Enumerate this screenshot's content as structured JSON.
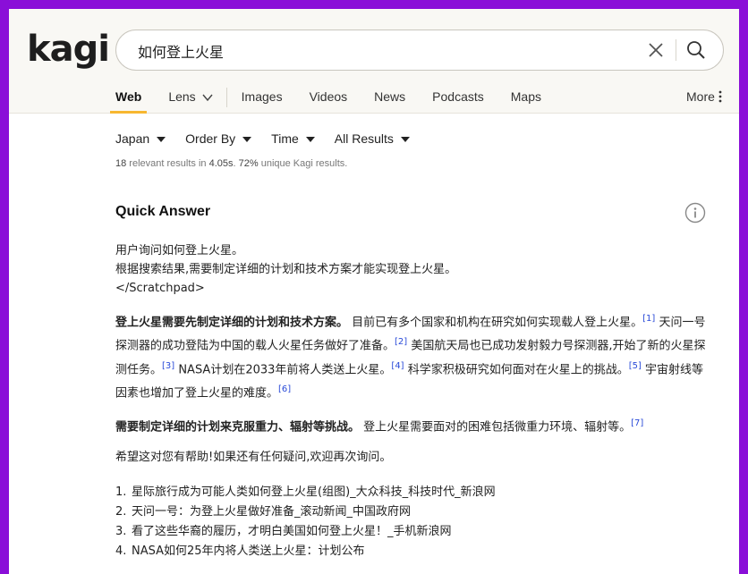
{
  "header": {
    "logo": "kagi",
    "search": {
      "value": "如何登上火星",
      "placeholder": ""
    }
  },
  "tabs": [
    {
      "label": "Web",
      "active": true
    },
    {
      "label": "Lens"
    },
    {
      "label": "Images"
    },
    {
      "label": "Videos"
    },
    {
      "label": "News"
    },
    {
      "label": "Podcasts"
    },
    {
      "label": "Maps"
    }
  ],
  "more_label": "More",
  "filters": [
    {
      "label": "Japan"
    },
    {
      "label": "Order By"
    },
    {
      "label": "Time"
    },
    {
      "label": "All Results"
    }
  ],
  "stats": {
    "count": "18",
    "text1": " relevant results in ",
    "time": "4.05s",
    "text2": ". ",
    "unique": "72%",
    "text3": " unique Kagi results."
  },
  "quick_answer": {
    "title": "Quick Answer",
    "intro_lines": [
      "用户询问如何登上火星。",
      "根据搜索结果,需要制定详细的计划和技术方案才能实现登上火星。",
      "</Scratchpad>"
    ],
    "para1": {
      "bold": "登上火星需要先制定详细的计划和技术方案。",
      "s1": " 目前已有多个国家和机构在研究如何实现载人登上火星。",
      "r1": "[1]",
      "s2": " 天问一号探测器的成功登陆为中国的载人火星任务做好了准备。",
      "r2": "[2]",
      "s3": " 美国航天局也已成功发射毅力号探测器,开始了新的火星探测任务。",
      "r3": "[3]",
      "s4": " NASA计划在2033年前将人类送上火星。",
      "r4": "[4]",
      "s5": " 科学家积极研究如何面对在火星上的挑战。",
      "r5": "[5]",
      "s6": " 宇宙射线等因素也增加了登上火星的难度。",
      "r6": "[6]"
    },
    "para2": {
      "bold": "需要制定详细的计划来克服重力、辐射等挑战。",
      "s1": " 登上火星需要面对的困难包括微重力环境、辐射等。",
      "r1": "[7]"
    },
    "closing": "希望这对您有帮助!如果还有任何疑问,欢迎再次询问。"
  },
  "references": [
    {
      "num": "1.",
      "text": "星际旅行成为可能人类如何登上火星(组图)_大众科技_科技时代_新浪网"
    },
    {
      "num": "2.",
      "text": "天问一号：为登上火星做好准备_滚动新闻_中国政府网"
    },
    {
      "num": "3.",
      "text": "看了这些华裔的履历，才明白美国如何登上火星！_手机新浪网"
    },
    {
      "num": "4.",
      "text": "NASA如何25年内将人类送上火星：计划公布"
    }
  ],
  "colors": {
    "frame_border": "#8a0fd8",
    "active_tab_underline": "#f7b730",
    "citation_link": "#2a4bd8"
  }
}
